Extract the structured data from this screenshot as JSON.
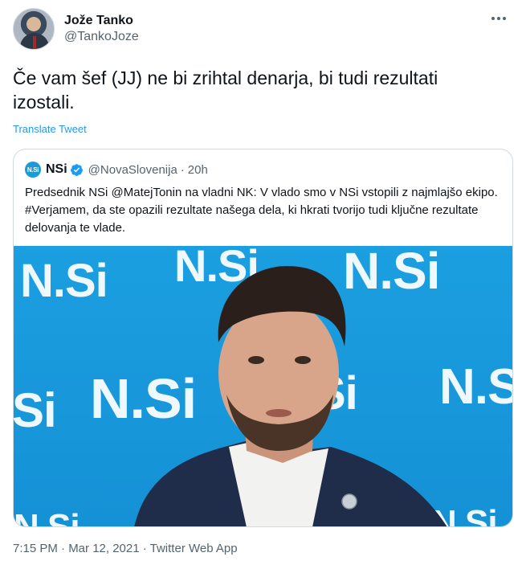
{
  "author": {
    "display_name": "Jože Tanko",
    "handle": "@TankoJoze",
    "avatar_icon": "avatar-photo"
  },
  "tweet": {
    "text": "Če vam šef (JJ) ne bi zrihtal denarja, bi tudi rezultati izostali.",
    "translate_label": "Translate Tweet"
  },
  "quoted": {
    "logo_text": "N.Si",
    "name": "NSi",
    "handle": "@NovaSlovenija",
    "separator": "·",
    "time": "20h",
    "text": "Predsednik NSi @MatejTonin na vladni NK: V vlado smo v NSi vstopili z najmlajšo ekipo. #Verjamem, da ste opazili rezultate našega dela, ki hkrati tvorijo tudi ključne rezultate delovanja te vlade.",
    "photo": {
      "watermarks": [
        "N.Si",
        "N.Si",
        "N.Si",
        "N.Si",
        "N.Si",
        "Si",
        "N.Si",
        "N.Si",
        "N.Si"
      ]
    }
  },
  "meta": {
    "timestamp": "7:15 PM · Mar 12, 2021 · Twitter Web App"
  },
  "colors": {
    "link": "#1d9bf0",
    "secondary_text": "#536471",
    "photo_background": "#1b9fe0"
  }
}
